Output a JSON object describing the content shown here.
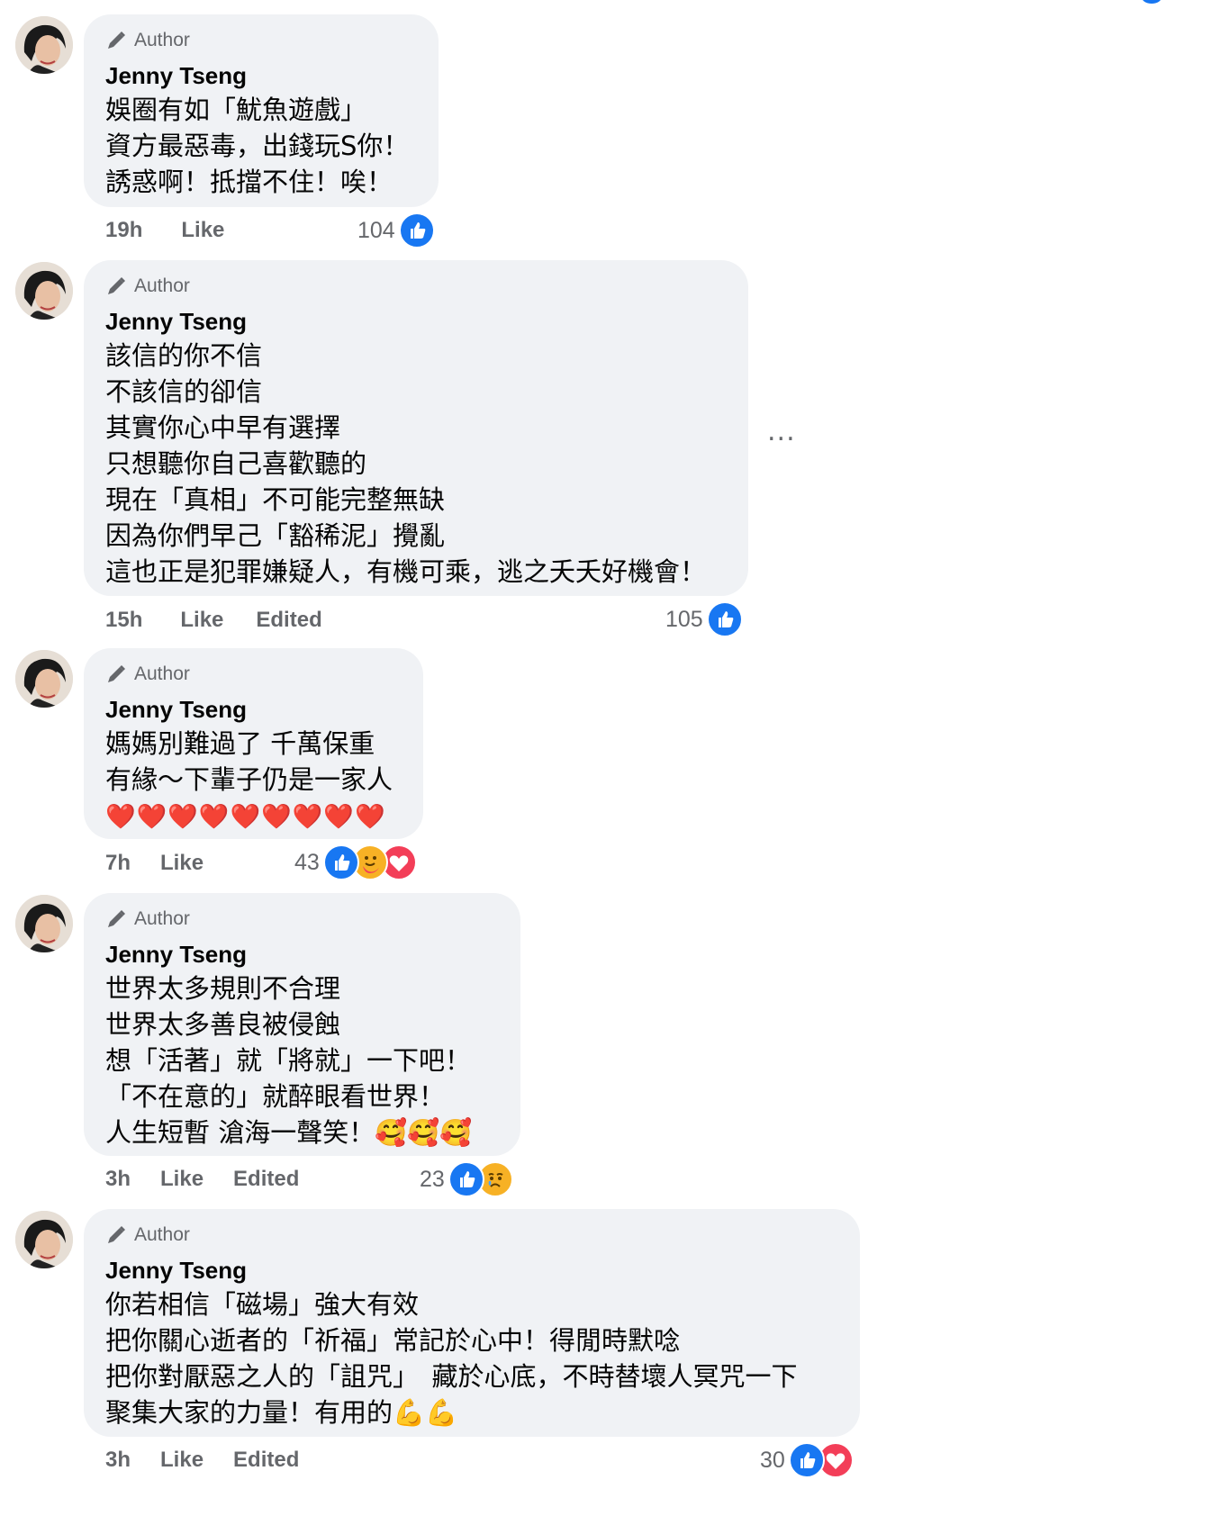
{
  "comments": [
    {
      "badge": "Author",
      "author": "Jenny Tseng",
      "lines": [
        "娛圈有如「魷魚遊戲」",
        "資方最惡毒，出錢玩S你！",
        "誘惑啊！抵擋不住！唉！"
      ],
      "time": "19h",
      "like_label": "Like",
      "edited": "",
      "reaction_count": "104",
      "reactions": [
        "like-icon"
      ]
    },
    {
      "badge": "Author",
      "author": "Jenny Tseng",
      "lines": [
        "該信的你不信",
        "不該信的卻信",
        "其實你心中早有選擇",
        "只想聽你自己喜歡聽的",
        "現在「真相」不可能完整無缺",
        "因為你們早己「豁稀泥」攪亂",
        "這也正是犯罪嫌疑人，有機可乘，逃之夭夭好機會！"
      ],
      "time": "15h",
      "like_label": "Like",
      "edited": "Edited",
      "reaction_count": "105",
      "reactions": [
        "like-icon"
      ]
    },
    {
      "badge": "Author",
      "author": "Jenny Tseng",
      "lines": [
        "媽媽別難過了 千萬保重",
        "有緣～下輩子仍是一家人"
      ],
      "hearts": "❤️❤️❤️❤️❤️❤️❤️❤️❤️",
      "time": "7h",
      "like_label": "Like",
      "edited": "",
      "reaction_count": "43",
      "reactions": [
        "like-icon",
        "care-icon",
        "love-icon"
      ]
    },
    {
      "badge": "Author",
      "author": "Jenny Tseng",
      "lines": [
        "世界太多規則不合理",
        "世界太多善良被侵蝕",
        "想「活著」就「將就」一下吧！",
        "「不在意的」就醉眼看世界！",
        "人生短暫 滄海一聲笑！🥰🥰🥰"
      ],
      "time": "3h",
      "like_label": "Like",
      "edited": "Edited",
      "reaction_count": "23",
      "reactions": [
        "like-icon",
        "sad-icon"
      ]
    },
    {
      "badge": "Author",
      "author": "Jenny Tseng",
      "lines": [
        "你若相信「磁場」強大有效",
        "把你關心逝者的「祈福」常記於心中！得閒時默唸",
        "把你對厭惡之人的「詛咒」　藏於心底，不時替壞人冥咒一下",
        "聚集大家的力量！有用的💪💪"
      ],
      "time": "3h",
      "like_label": "Like",
      "edited": "Edited",
      "reaction_count": "30",
      "reactions": [
        "like-icon",
        "love-icon"
      ]
    }
  ],
  "more_options_label": "...",
  "colors": {
    "bubble": "#f0f2f5",
    "meta": "#65676b",
    "like_blue": "#1877f2",
    "love_red": "#f33e58"
  }
}
